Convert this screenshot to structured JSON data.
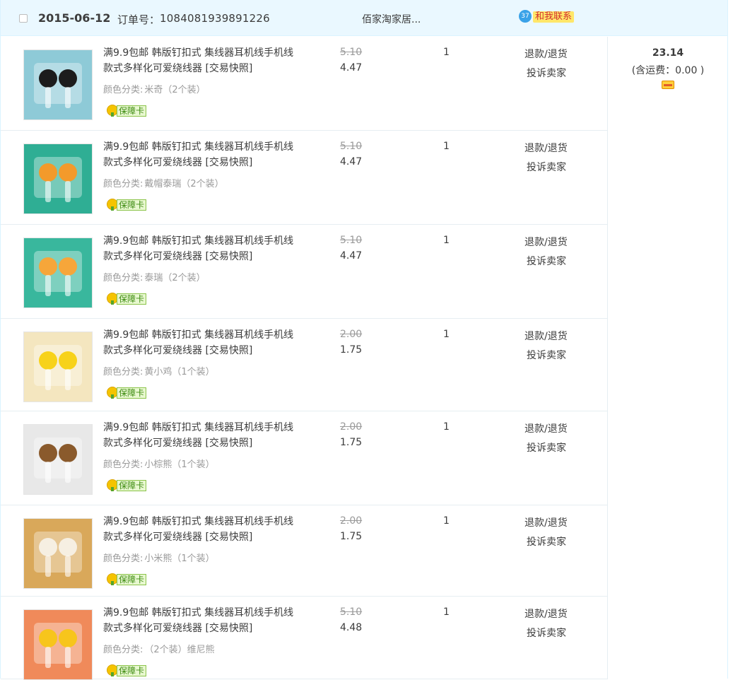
{
  "order": {
    "date": "2015-06-12",
    "order_no_label": "订单号：",
    "order_no": "1084081939891226",
    "shop_name": "佰家淘家居...",
    "contact_label": "和我联系",
    "total": "23.14",
    "shipping": "(含运费：0.00 )"
  },
  "common": {
    "title": "满9.9包邮 韩版钉扣式 集线器耳机线手机线 款式多样化可爱绕线器 [交易快照]",
    "variant_key": "颜色分类:",
    "guarantee": "保障卡",
    "refund": "退款/退货",
    "complain": "投诉卖家"
  },
  "items": [
    {
      "variant": "米奇（2个装）",
      "orig_price": "5.10",
      "price": "4.47",
      "qty": "1",
      "thumb_color": "#8ecad7",
      "thumb_accent": "#1c1c1c"
    },
    {
      "variant": "戴帽泰瑞（2个装）",
      "orig_price": "5.10",
      "price": "4.47",
      "qty": "1",
      "thumb_color": "#2fae94",
      "thumb_accent": "#f39a2b"
    },
    {
      "variant": "泰瑞（2个装）",
      "orig_price": "5.10",
      "price": "4.47",
      "qty": "1",
      "thumb_color": "#39b79d",
      "thumb_accent": "#f6a63a"
    },
    {
      "variant": "黄小鸡（1个装）",
      "orig_price": "2.00",
      "price": "1.75",
      "qty": "1",
      "thumb_color": "#f4e6bf",
      "thumb_accent": "#f7d21a"
    },
    {
      "variant": "小棕熊（1个装）",
      "orig_price": "2.00",
      "price": "1.75",
      "qty": "1",
      "thumb_color": "#e8e8e8",
      "thumb_accent": "#8a5a2c"
    },
    {
      "variant": "小米熊（1个装）",
      "orig_price": "2.00",
      "price": "1.75",
      "qty": "1",
      "thumb_color": "#d9a85a",
      "thumb_accent": "#f6efe2"
    },
    {
      "variant": "（2个装）维尼熊",
      "orig_price": "5.10",
      "price": "4.48",
      "qty": "1",
      "thumb_color": "#f08a5a",
      "thumb_accent": "#f7c51c"
    }
  ]
}
